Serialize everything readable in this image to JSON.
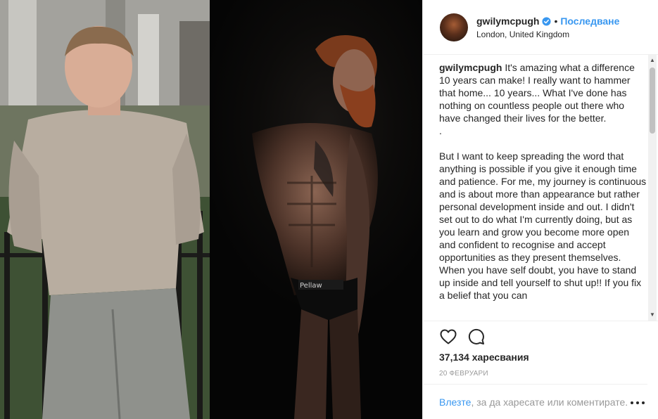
{
  "header": {
    "username": "gwilymcpugh",
    "separator": "•",
    "follow_label": "Последване",
    "location": "London, United Kingdom"
  },
  "caption": {
    "username": "gwilymcpugh",
    "paragraph1": "It's amazing what a difference 10 years can make! I really want to hammer that home... 10 years... What I've done has nothing on countless people out there who have changed their lives for the better.",
    "dot_line": ".",
    "paragraph2": "But I want to keep spreading the word that anything is possible if you give it enough time and patience. For me, my journey is continuous and is about more than appearance but rather personal development inside and out. I didn't set out to do what I'm currently doing, but as you learn and grow you become more open and confident to recognise and accept opportunities as they present themselves. When you have self doubt, you have to stand up inside and tell yourself to shut up!! If you fix a belief that you can"
  },
  "photo": {
    "brand_text": "Pellaw"
  },
  "stats": {
    "likes": "37,134 харесвания",
    "date": "20 ФЕВРУАРИ"
  },
  "footer": {
    "login_link": "Влезте",
    "login_rest": ", за да харесате или коментирате."
  },
  "icons": {
    "heart": "heart-icon",
    "comment": "comment-icon",
    "verified": "verified-badge-icon",
    "more": "more-options-icon"
  },
  "colors": {
    "accent": "#3897f0",
    "text": "#262626",
    "muted": "#999999",
    "border": "#efefef"
  }
}
